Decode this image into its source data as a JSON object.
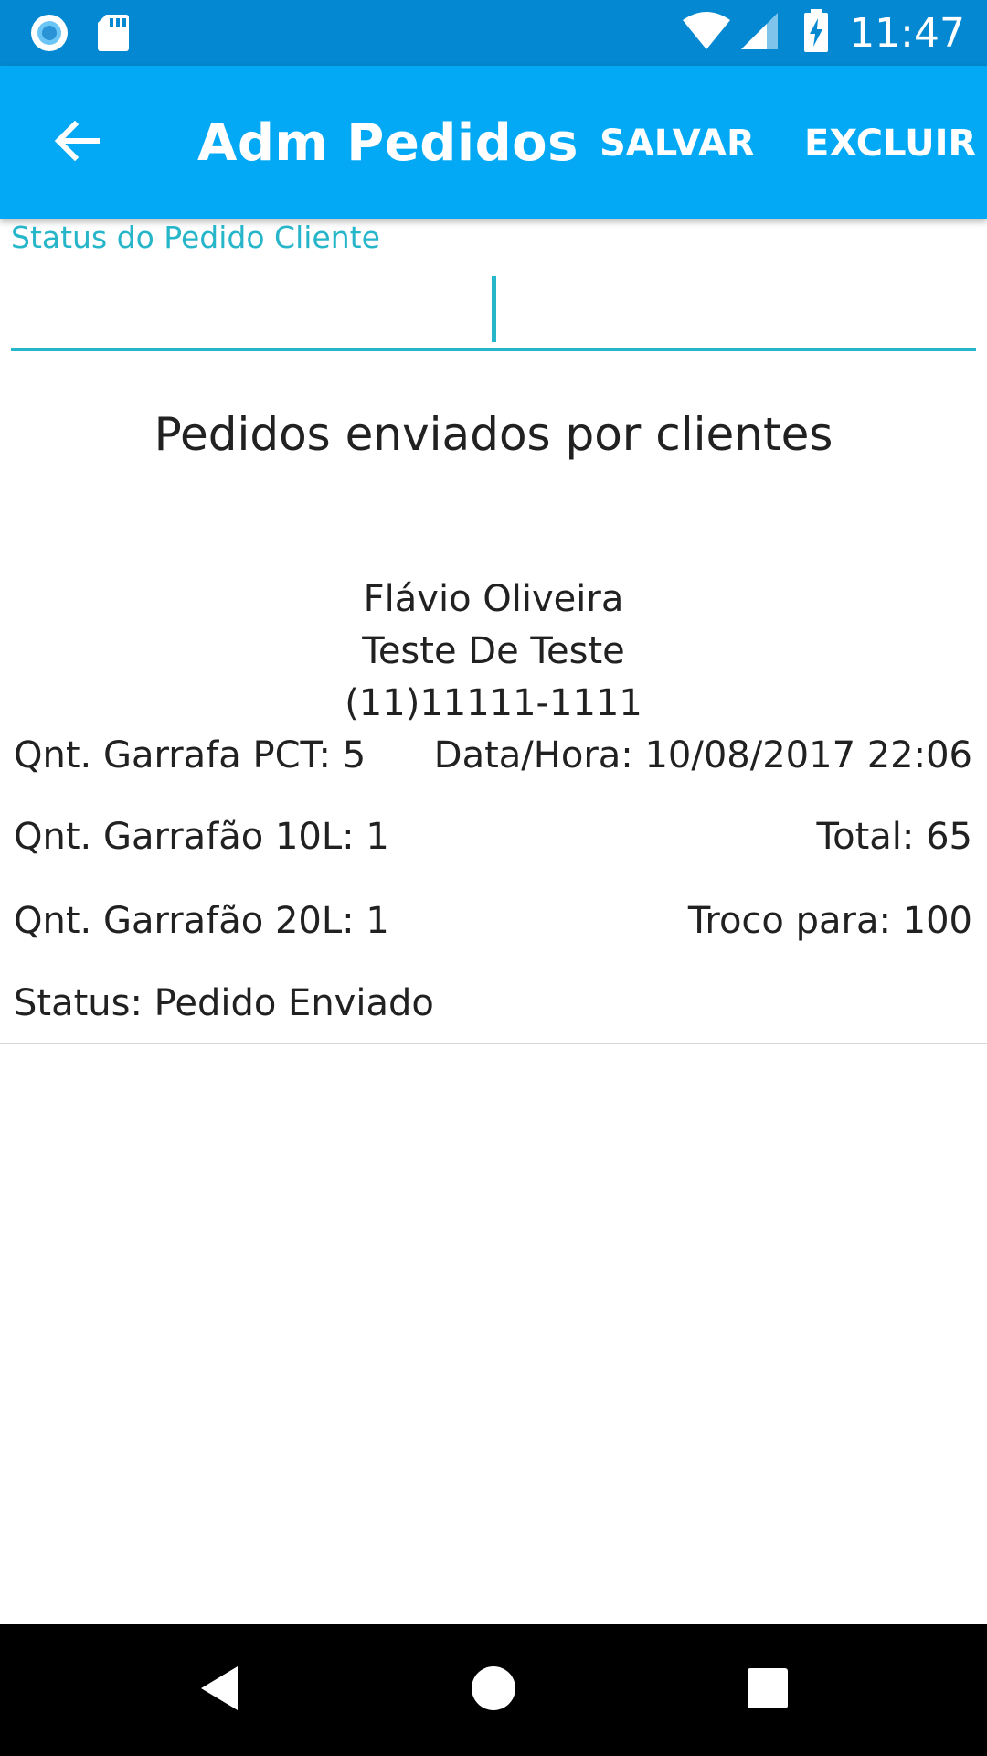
{
  "status_bar": {
    "time": "11:47",
    "icons": [
      "notification-circle-icon",
      "sd-card-icon",
      "wifi-icon",
      "cell-signal-icon",
      "battery-charging-icon"
    ]
  },
  "app_bar": {
    "back_icon": "arrow-left-icon",
    "title": "Adm Pedidos",
    "save_label": "SALVAR",
    "delete_label": "EXCLUIR"
  },
  "status_field": {
    "label": "Status do Pedido Cliente",
    "value": ""
  },
  "section_heading": "Pedidos enviados por clientes",
  "orders": [
    {
      "client_name": "Flávio Oliveira",
      "address": "Teste De Teste",
      "phone": "(11)11111-1111",
      "garrafa_pct": "Qnt. Garrafa PCT: 5",
      "datetime": "Data/Hora: 10/08/2017 22:06",
      "garrafao_10l": "Qnt. Garrafão 10L: 1",
      "total": "Total: 65",
      "garrafao_20l": "Qnt. Garrafão 20L: 1",
      "troco": "Troco para: 100",
      "status": "Status: Pedido Enviado"
    }
  ],
  "nav_bar": {
    "icons": [
      "nav-back-icon",
      "nav-home-icon",
      "nav-recents-icon"
    ]
  },
  "colors": {
    "status_bar": "#0388d1",
    "app_bar": "#03a9f4",
    "accent": "#26b5c9",
    "text": "#212121",
    "nav_bar": "#000000"
  }
}
